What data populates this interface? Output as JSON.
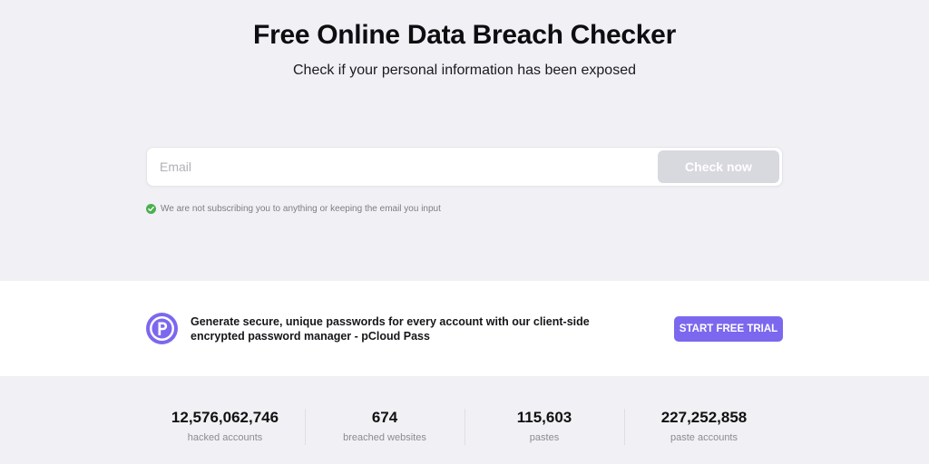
{
  "hero": {
    "title": "Free Online Data Breach Checker",
    "subtitle": "Check if your personal information has been exposed"
  },
  "search": {
    "placeholder": "Email",
    "value": "",
    "button_label": "Check now"
  },
  "notice": {
    "text": "We are not subscribing you to anything or keeping the email you input",
    "icon": "check-circle-icon",
    "icon_color": "#4caf50"
  },
  "promo": {
    "logo_icon": "pcloud-pass-logo",
    "text": "Generate secure, unique passwords for every account with our client-side encrypted password manager - pCloud Pass",
    "button_label": "START FREE TRIAL",
    "accent_color": "#7b68ee"
  },
  "stats": [
    {
      "value": "12,576,062,746",
      "label": "hacked accounts"
    },
    {
      "value": "674",
      "label": "breached websites"
    },
    {
      "value": "115,603",
      "label": "pastes"
    },
    {
      "value": "227,252,858",
      "label": "paste accounts"
    }
  ]
}
